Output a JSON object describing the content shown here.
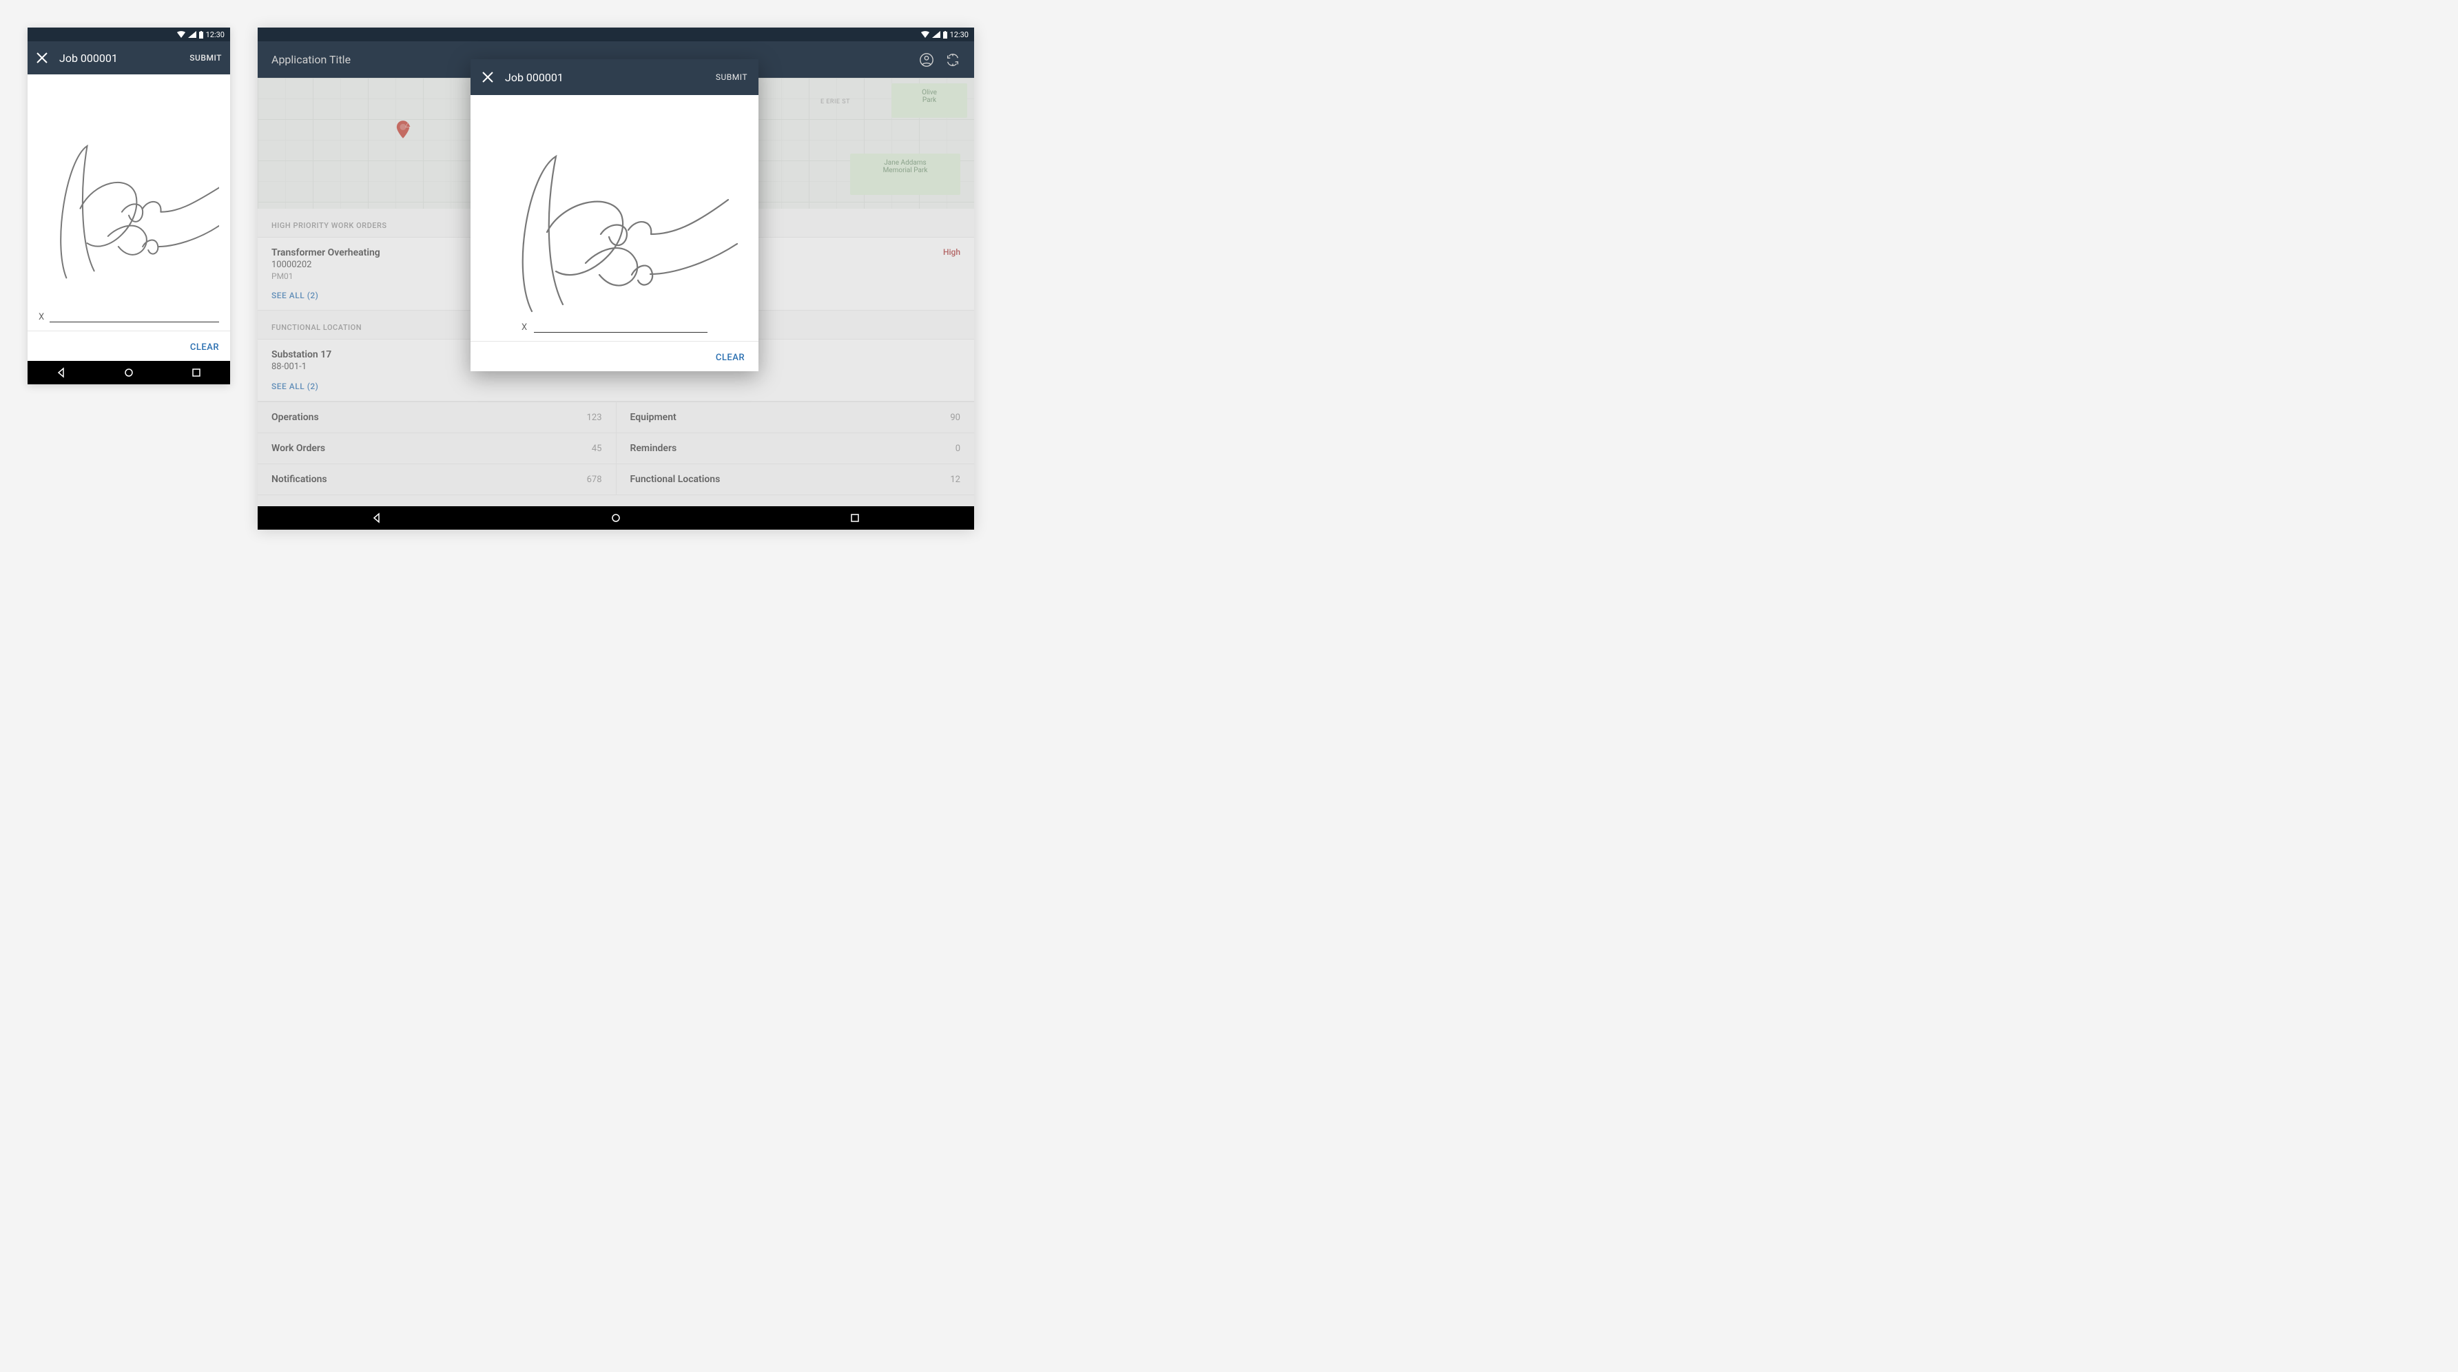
{
  "time": "12:30",
  "phone": {
    "title": "Job 000001",
    "submit": "SUBMIT",
    "sign_marker": "X",
    "clear": "CLEAR"
  },
  "tablet": {
    "app_title": "Application Title",
    "parks": {
      "olive": "Olive\nPark",
      "jane": "Jane Addams\nMemorial Park"
    },
    "street": "E ERIE ST",
    "sections": {
      "hp": "HIGH PRIORITY WORK ORDERS",
      "fl": "FUNCTIONAL LOCATION"
    },
    "hp_item": {
      "title": "Transformer Overheating",
      "id": "10000202",
      "type": "PM01",
      "badge": "High"
    },
    "see_all": "SEE ALL (2)",
    "fl_item": {
      "title": "Substation 17",
      "id": "88-001-1"
    },
    "rows_left": [
      {
        "label": "Operations",
        "count": "123"
      },
      {
        "label": "Work Orders",
        "count": "45"
      },
      {
        "label": "Notifications",
        "count": "678"
      }
    ],
    "rows_right": [
      {
        "label": "Equipment",
        "count": "90"
      },
      {
        "label": "Reminders",
        "count": "0"
      },
      {
        "label": "Functional Locations",
        "count": "12"
      }
    ],
    "dialog": {
      "title": "Job 000001",
      "submit": "SUBMIT",
      "sign_marker": "X",
      "clear": "CLEAR"
    }
  }
}
